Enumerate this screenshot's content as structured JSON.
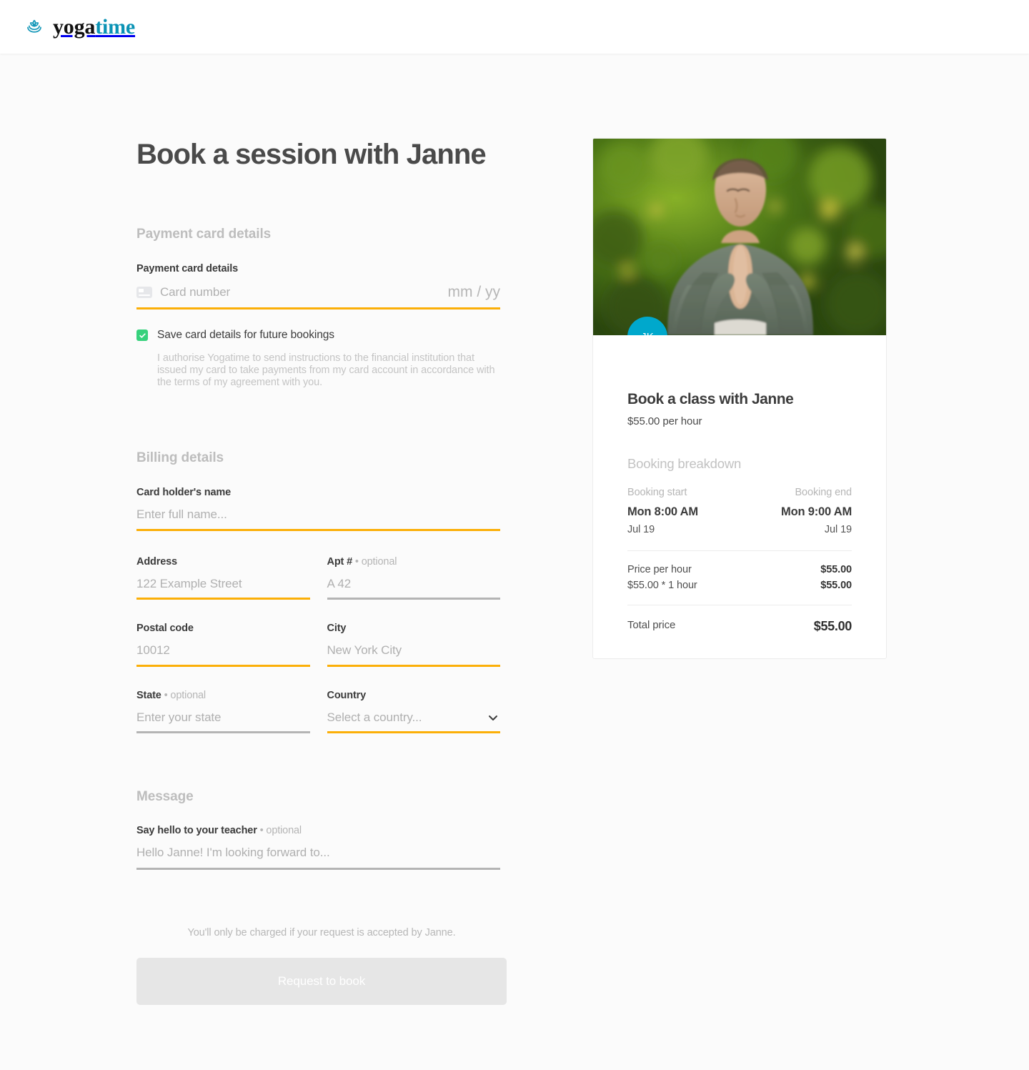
{
  "header": {
    "logo_icon": "lotus-icon",
    "logo_part1": "yoga",
    "logo_part2": "time"
  },
  "colors": {
    "accent_orange": "#fbaf08",
    "brand_teal": "#0b93b5",
    "avatar_blue": "#00a8cc",
    "checkbox_green": "#36d17c",
    "inactive_gray": "#b4b4b4",
    "disabled_button": "#e6e6e6"
  },
  "main": {
    "page_title": "Book a session with Janne",
    "payment_section": {
      "heading": "Payment card details",
      "card_field_label": "Payment card details",
      "card_number_placeholder": "Card number",
      "card_icon": "credit-card-icon",
      "expiry_placeholder": "mm / yy",
      "save_card_label": "Save card details for future bookings",
      "save_card_checked": true,
      "disclaimer": "I authorise Yogatime to send instructions to the financial institution that issued my card to take payments from my card account in accordance with the terms of my agreement with you."
    },
    "billing_section": {
      "heading": "Billing details",
      "fields": {
        "card_holder": {
          "label": "Card holder's name",
          "placeholder": "Enter full name...",
          "value": "",
          "active": true
        },
        "address": {
          "label": "Address",
          "placeholder": "122 Example Street",
          "value": "",
          "active": true
        },
        "apt": {
          "label": "Apt #",
          "optional": "• optional",
          "placeholder": "A 42",
          "value": "",
          "active": false
        },
        "postal_code": {
          "label": "Postal code",
          "placeholder": "10012",
          "value": "",
          "active": true
        },
        "city": {
          "label": "City",
          "placeholder": "New York City",
          "value": "",
          "active": true
        },
        "state": {
          "label": "State",
          "optional": "• optional",
          "placeholder": "Enter your state",
          "value": "",
          "active": false
        },
        "country": {
          "label": "Country",
          "placeholder": "Select a country...",
          "value": "",
          "active": true,
          "chevron_icon": "chevron-down-icon"
        }
      }
    },
    "message_section": {
      "heading": "Message",
      "label": "Say hello to your teacher",
      "optional": "• optional",
      "placeholder": "Hello Janne! I'm looking forward to...",
      "value": ""
    },
    "footer": {
      "charge_note": "You'll only be charged if your request is accepted by Janne.",
      "cta_label": "Request to book",
      "cta_disabled": true
    }
  },
  "booking_card": {
    "photo_alt": "teacher-photo",
    "avatar_initials": "JK",
    "title": "Book a class with Janne",
    "rate": "$55.00 per hour",
    "breakdown_heading": "Booking breakdown",
    "start_caption": "Booking start",
    "end_caption": "Booking end",
    "start_time": "Mon 8:00 AM",
    "end_time": "Mon 9:00 AM",
    "start_date": "Jul 19",
    "end_date": "Jul 19",
    "lines": [
      {
        "label": "Price per hour",
        "amount": "$55.00"
      },
      {
        "label": "$55.00 * 1 hour",
        "amount": "$55.00"
      }
    ],
    "total_label": "Total price",
    "total_amount": "$55.00"
  }
}
